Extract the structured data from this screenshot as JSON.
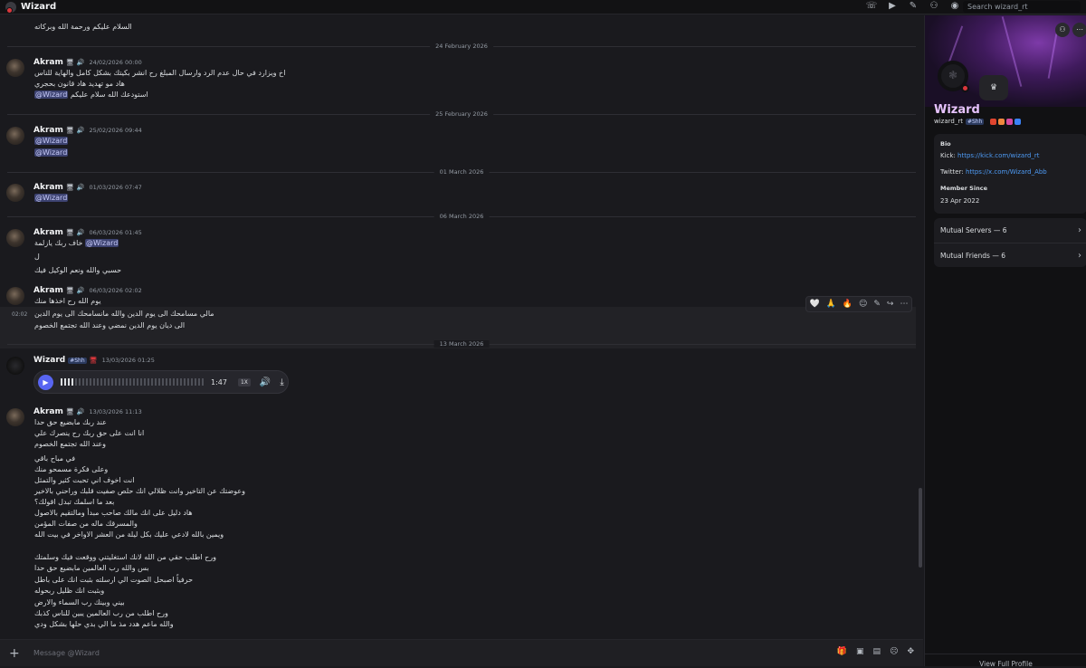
{
  "window": {
    "title": "Wizard"
  },
  "topbar": {
    "icons": [
      "phone-icon",
      "video-icon",
      "pin-icon",
      "add-friend-icon",
      "profile-icon"
    ],
    "search_placeholder": "Search wizard_rt"
  },
  "chat": {
    "top_line": "السلام عليكم ورحمة الله وبركاته",
    "dates": [
      "24 February 2026",
      "25 February 2026",
      "01 March 2026",
      "06 March 2026",
      "13 March 2026"
    ],
    "messages": [
      {
        "author": "Akram",
        "time": "24/02/2026 00:00",
        "lines": [
          "اخ ويزارد في حال عدم الرد وارسال المبلغ رح انشر بكيتك بشكل كامل والهاية للناس",
          "هاد مو تهديد هاد قانون بحجري",
          "استودعك الله سلام عليكم"
        ],
        "mention": "@Wizard"
      },
      {
        "author": "Akram",
        "time": "25/02/2026 09:44",
        "mentions": [
          "@Wizard",
          "@Wizard"
        ]
      },
      {
        "author": "Akram",
        "time": "01/03/2026 07:47",
        "mentions": [
          "@Wizard"
        ]
      },
      {
        "author": "Akram",
        "time": "06/03/2026 01:45",
        "lines": [
          "خاف ربك يازلمة",
          "ل",
          "حسبي والله ونعم الوكيل فيك"
        ],
        "mention": "@Wizard"
      },
      {
        "author": "Akram",
        "time": "06/03/2026 02:02",
        "lines": [
          "يوم الله رح اخذها منك",
          "مالي مسامحك الى يوم الدين والله مانسامحك الى يوم الدين",
          "الى ديان يوم الدين نمضي وعند الله تجتمع الخصوم"
        ],
        "stamp": "02:02"
      },
      {
        "author": "Wizard",
        "time": "13/03/2026 01:25",
        "tag": "#Shh",
        "voice": {
          "duration": "1:47",
          "speed": "1X"
        }
      },
      {
        "author": "Akram",
        "time": "13/03/2026 11:13",
        "lines": [
          "عند ربك مابضيع حق حدا",
          "انا انت على حق ربك رح ينصرك علي",
          "وعند الله تجتمع الخصوم",
          "",
          "في مباح باقي",
          "وعلى فكرة مسمحو منك",
          "انت اخوف اني تحبت كثير والتمثل",
          "وعوضتك عن التاخير وانت ظلالي انك حلص صفيت قلبك وراحني بالاخير",
          "بعد ما اسلمك تبدل اقولك؟",
          "هاد دليل على انك مالك صاحب مبدأ ومالتقيم بالاصول",
          "والمسرقك ماله من صفات المؤمن",
          "ويمين بالله لادعي عليك بكل ليلة من العشر الاواخر في بيت الله",
          "",
          "ورح اطلب حقي من الله لانك استغليتني ووقعت فيك وسلمتك",
          "بس والله رب العالمين مابضيع حق حدا",
          "حرفياً اصبحل الصوت الي ارسلته بثبت انك على باطل",
          "وبثبت انك ظليل ربحوله",
          "بيني وبينك رب السماء والارض",
          "ورح اطلب من رب العالمين يبين للناس كذبك",
          "والله ماعم هدد مذ ما الي بدي حلها بشكل ودي"
        ]
      }
    ],
    "toolbar_reactions": [
      "🤍",
      "🙏",
      "🔥"
    ],
    "toolbar_icons": [
      "add-reaction-icon",
      "edit-icon",
      "reply-icon",
      "more-icon"
    ]
  },
  "composer": {
    "placeholder": "Message @Wizard",
    "icons": [
      "gift-icon",
      "gif-icon",
      "sticker-icon",
      "emoji-icon",
      "apps-icon"
    ]
  },
  "profile": {
    "name": "Wizard",
    "username": "wizard_rt",
    "tag": "#Shh",
    "status_emoji": "♛",
    "bio_label": "Bio",
    "kick_prefix": "Kick:",
    "kick_url": "https://kick.com/wizard_rt",
    "twitter_prefix": "Twitter:",
    "twitter_url": "https://x.com/Wizard_Abb",
    "member_since_label": "Member Since",
    "member_since": "23 Apr 2022",
    "mutual_servers": "Mutual Servers — 6",
    "mutual_friends": "Mutual Friends — 6",
    "view_full": "View Full Profile",
    "badge_colors": [
      "#e0452f",
      "#f0883e",
      "#d64aa0",
      "#3b82f6"
    ]
  }
}
